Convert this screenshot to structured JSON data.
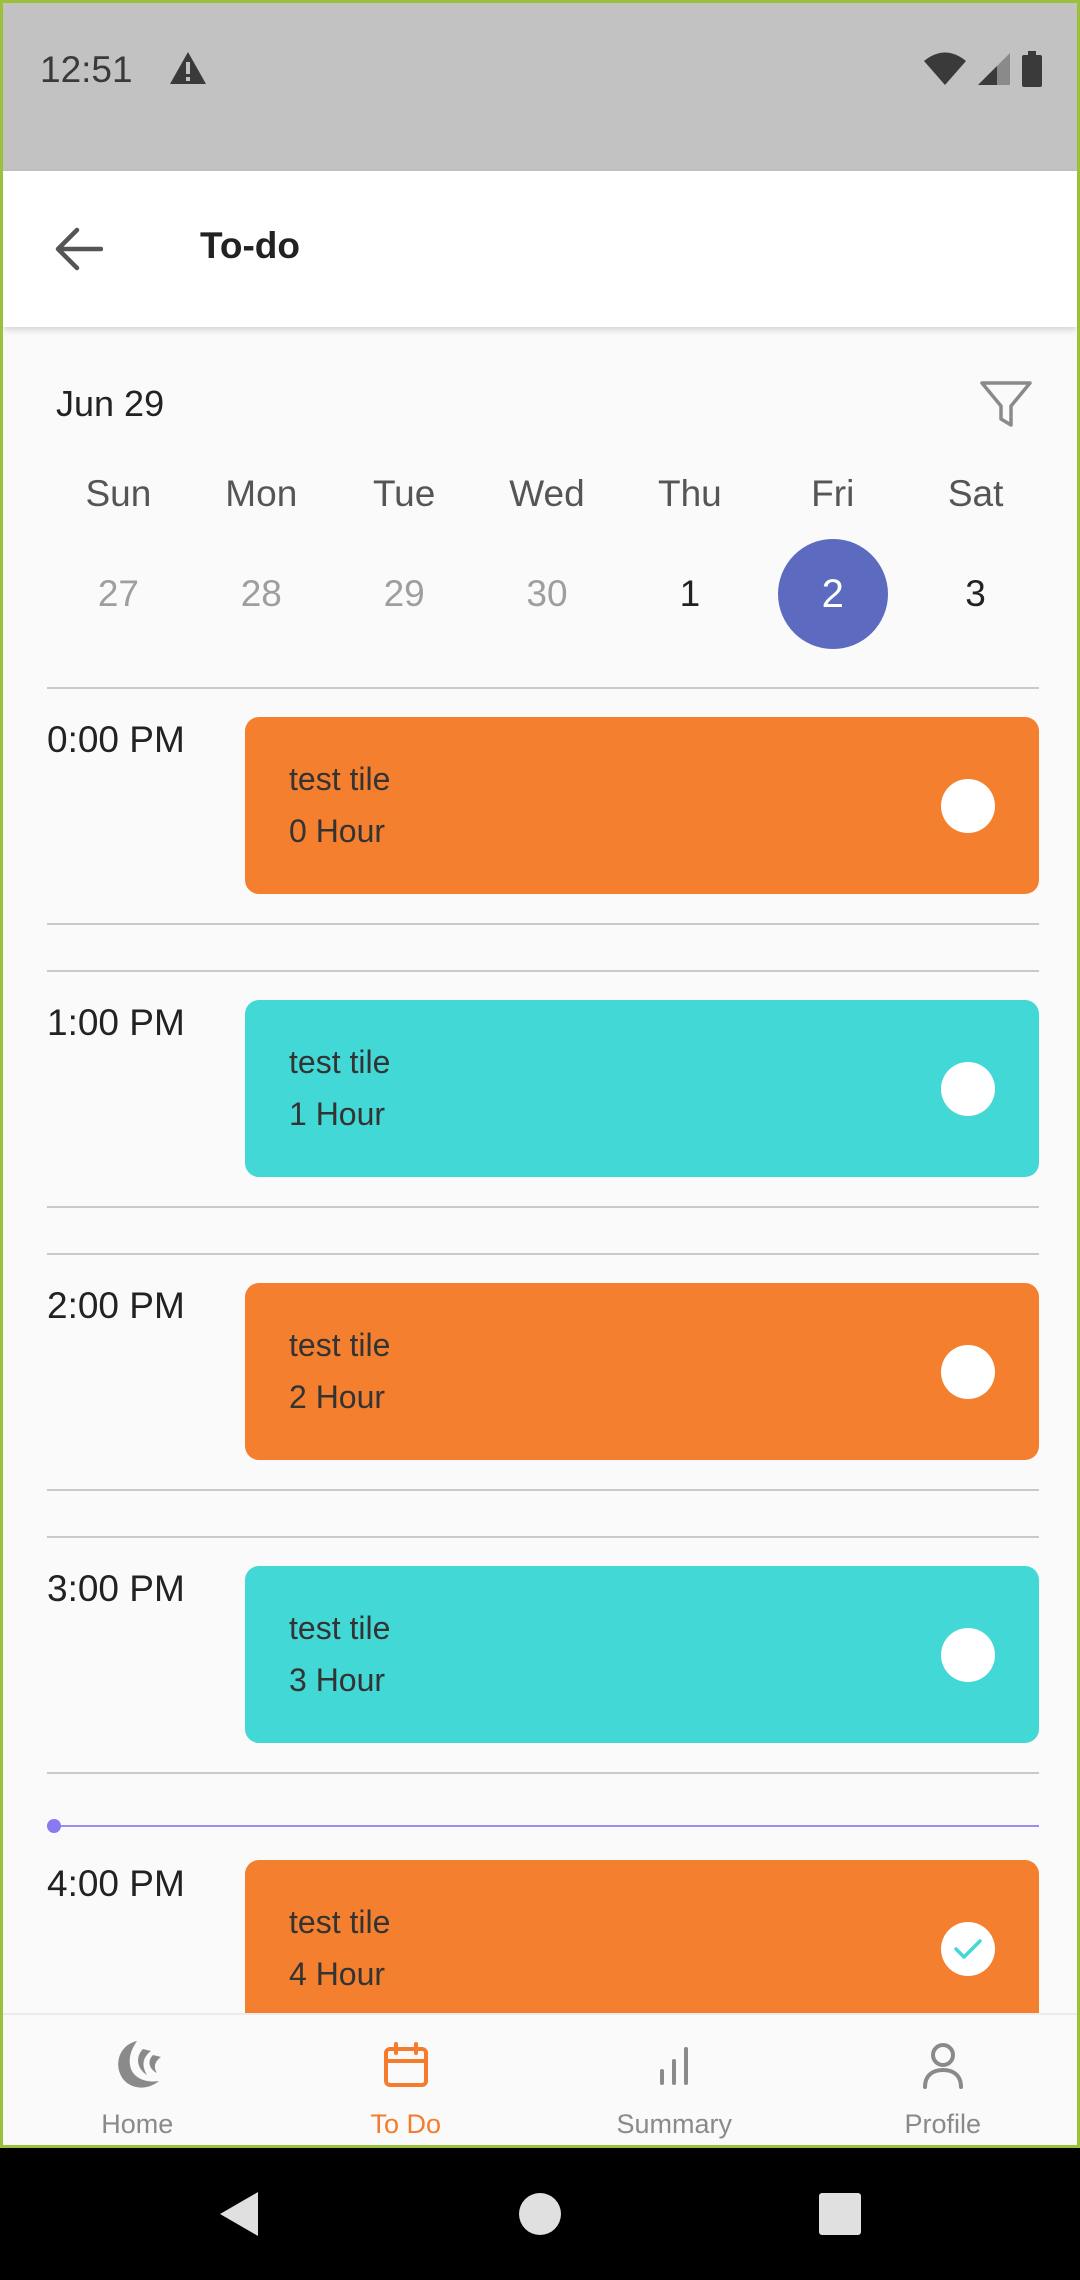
{
  "status_bar": {
    "time": "12:51",
    "icons": [
      "warning-icon",
      "wifi-icon",
      "signal-icon",
      "battery-icon"
    ]
  },
  "app_bar": {
    "title": "To-do",
    "back_icon": "back-arrow-icon"
  },
  "calendar": {
    "month_label": "Jun 29",
    "filter_icon": "filter-icon",
    "weekdays": [
      "Sun",
      "Mon",
      "Tue",
      "Wed",
      "Thu",
      "Fri",
      "Sat"
    ],
    "days": [
      "27",
      "28",
      "29",
      "30",
      "1",
      "2",
      "3"
    ],
    "selected_index": 5,
    "colors": {
      "selected": "#5c6bc0",
      "muted": "#9e9e9e"
    }
  },
  "timeline": {
    "slots": [
      {
        "time": "0:00 PM",
        "title": "test tile",
        "duration": "0 Hour",
        "color": "#f47f2e",
        "completed": false
      },
      {
        "time": "1:00 PM",
        "title": "test tile",
        "duration": "1 Hour",
        "color": "#42d8d6",
        "completed": false
      },
      {
        "time": "2:00 PM",
        "title": "test tile",
        "duration": "2 Hour",
        "color": "#f47f2e",
        "completed": false
      },
      {
        "time": "3:00 PM",
        "title": "test tile",
        "duration": "3 Hour",
        "color": "#42d8d6",
        "completed": false
      },
      {
        "time": "4:00 PM",
        "title": "test tile",
        "duration": "4 Hour",
        "color": "#f47f2e",
        "completed": true
      }
    ]
  },
  "bottom_nav": {
    "items": [
      {
        "label": "Home",
        "icon": "home-logo-icon",
        "active": false
      },
      {
        "label": "To Do",
        "icon": "calendar-icon",
        "active": true
      },
      {
        "label": "Summary",
        "icon": "bar-chart-icon",
        "active": false
      },
      {
        "label": "Profile",
        "icon": "person-icon",
        "active": false
      }
    ],
    "active_color": "#f57c2c"
  },
  "system_nav": [
    "back-triangle-icon",
    "home-circle-icon",
    "recents-square-icon"
  ]
}
